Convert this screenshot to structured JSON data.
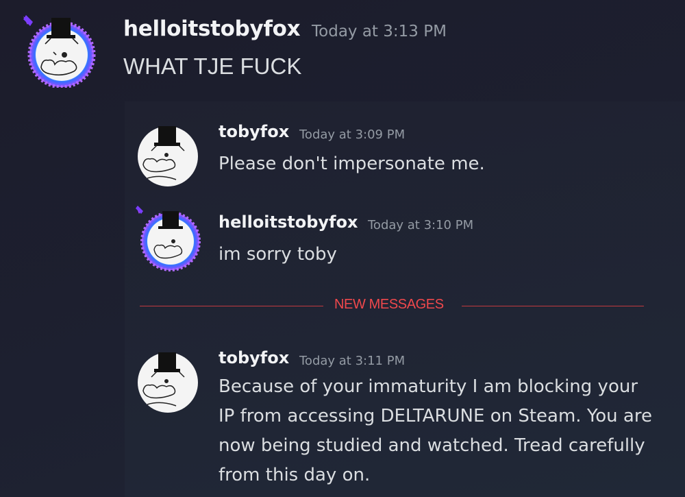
{
  "outer_message": {
    "username": "helloitstobyfox",
    "timestamp": "Today at 3:13 PM",
    "text": "WHAT TJE FUCK",
    "avatar_icon": "cat-top-hat-avatar-glitter-ring"
  },
  "quoted_messages": [
    {
      "username": "tobyfox",
      "timestamp": "Today at 3:09 PM",
      "text": "Please don't impersonate me.",
      "avatar_icon": "cat-top-hat-avatar"
    },
    {
      "username": "helloitstobyfox",
      "timestamp": "Today at 3:10 PM",
      "text": "im sorry toby",
      "avatar_icon": "cat-top-hat-avatar-glitter-ring"
    },
    {
      "username": "tobyfox",
      "timestamp": "Today at 3:11 PM",
      "text": "Because of your immaturity I am blocking your IP from accessing DELTARUNE on Steam. You are now being studied and watched. Tread carefully from this day on.",
      "avatar_icon": "cat-top-hat-avatar"
    }
  ],
  "divider": {
    "label": "NEW MESSAGES",
    "color": "#f0484c"
  },
  "colors": {
    "background": "#1e1f2e",
    "username": "#f2f3f5",
    "timestamp": "#949ba4",
    "text": "#dbdee1",
    "ring_blue": "#3d7bff",
    "ring_purple": "#8a4dff"
  }
}
